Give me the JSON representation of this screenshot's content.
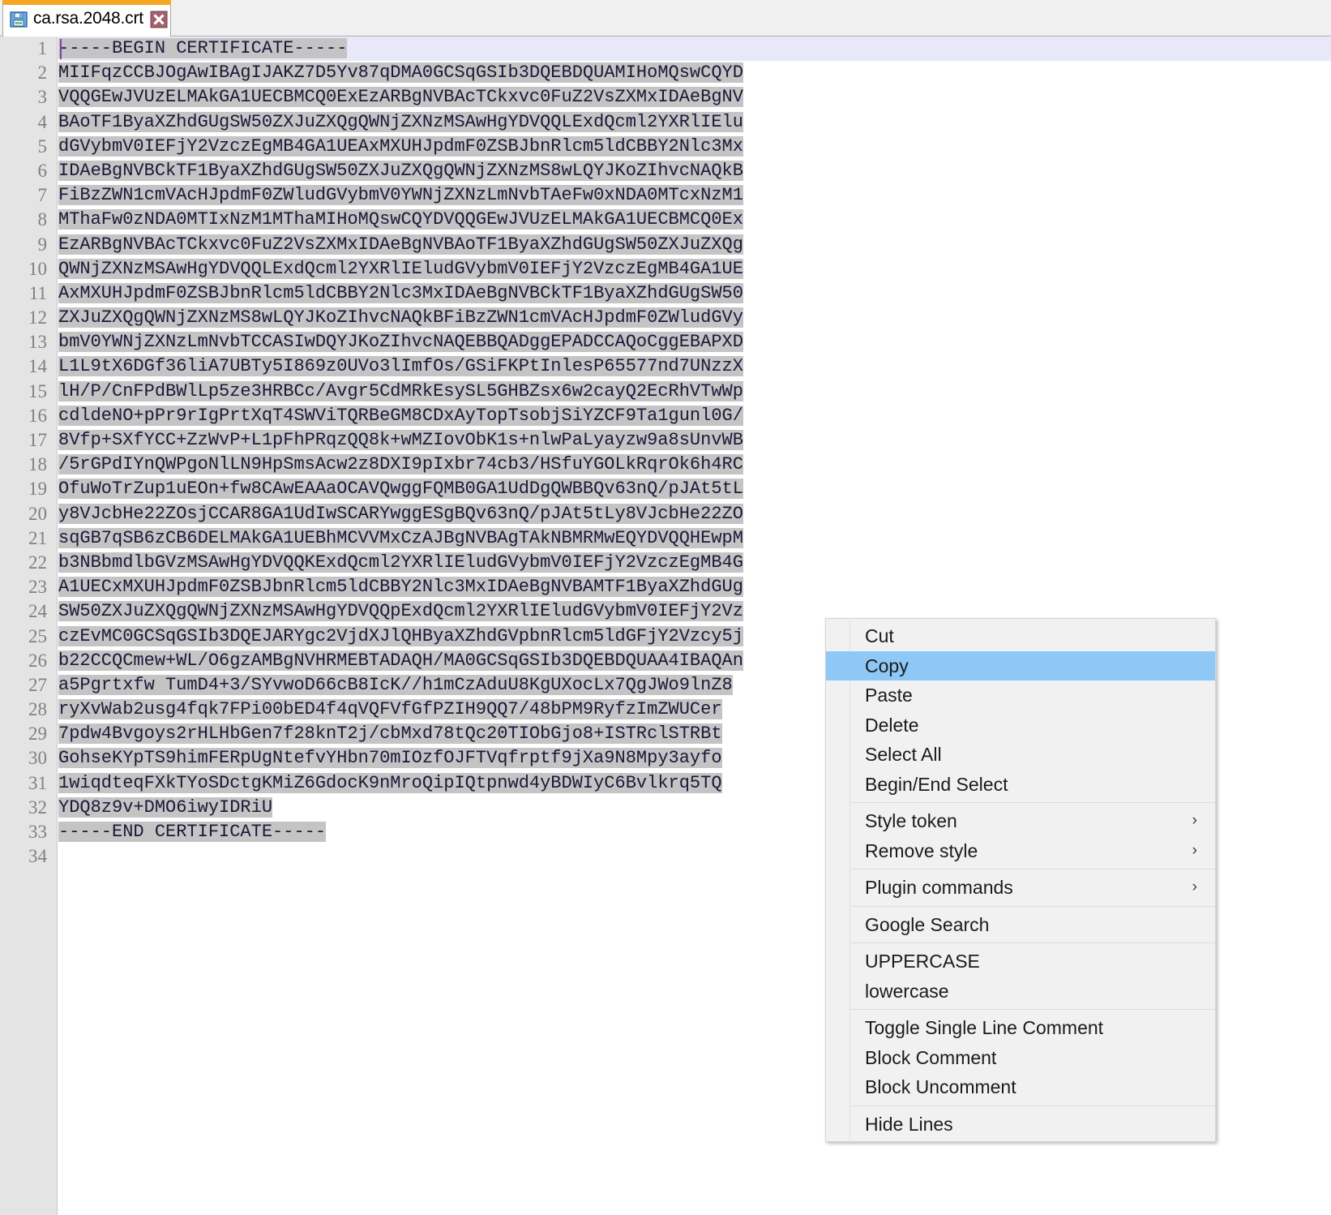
{
  "window": {
    "app": "Notepad++",
    "accent_active_tab": "#f5a623",
    "selection_color": "#c4c4c4",
    "menu_highlight_color": "#8ec8f6"
  },
  "tab": {
    "label": "ca.rsa.2048.crt",
    "icon": "save-floppy-icon",
    "close_icon": "close-x-icon"
  },
  "editor": {
    "total_lines": 34,
    "current_line": 1,
    "line_numbers": [
      1,
      2,
      3,
      4,
      5,
      6,
      7,
      8,
      9,
      10,
      11,
      12,
      13,
      14,
      15,
      16,
      17,
      18,
      19,
      20,
      21,
      22,
      23,
      24,
      25,
      26,
      27,
      28,
      29,
      30,
      31,
      32,
      33,
      34
    ],
    "lines": [
      "-----BEGIN CERTIFICATE-----",
      "MIIFqzCCBJOgAwIBAgIJAKZ7D5Yv87qDMA0GCSqGSIb3DQEBDQUAMIHoMQswCQYD",
      "VQQGEwJVUzELMAkGA1UECBMCQ0ExEzARBgNVBAcTCkxvc0FuZ2VsZXMxIDAeBgNV",
      "BAoTF1ByaXZhdGUgSW50ZXJuZXQgQWNjZXNzMSAwHgYDVQQLExdQcml2YXRlIElu",
      "dGVybmV0IEFjY2VzczEgMB4GA1UEAxMXUHJpdmF0ZSBJbnRlcm5ldCBBY2Nlc3Mx",
      "IDAeBgNVBCkTF1ByaXZhdGUgSW50ZXJuZXQgQWNjZXNzMS8wLQYJKoZIhvcNAQkB",
      "FiBzZWN1cmVAcHJpdmF0ZWludGVybmV0YWNjZXNzLmNvbTAeFw0xNDA0MTcxNzM1",
      "MThaFw0zNDA0MTIxNzM1MThaMIHoMQswCQYDVQQGEwJVUzELMAkGA1UECBMCQ0Ex",
      "EzARBgNVBAcTCkxvc0FuZ2VsZXMxIDAeBgNVBAoTF1ByaXZhdGUgSW50ZXJuZXQg",
      "QWNjZXNzMSAwHgYDVQQLExdQcml2YXRlIEludGVybmV0IEFjY2VzczEgMB4GA1UE",
      "AxMXUHJpdmF0ZSBJbnRlcm5ldCBBY2Nlc3MxIDAeBgNVBCkTF1ByaXZhdGUgSW50",
      "ZXJuZXQgQWNjZXNzMS8wLQYJKoZIhvcNAQkBFiBzZWN1cmVAcHJpdmF0ZWludGVy",
      "bmV0YWNjZXNzLmNvbTCCASIwDQYJKoZIhvcNAQEBBQADggEPADCCAQoCggEBAPXD",
      "L1L9tX6DGf36liA7UBTy5I869z0UVo3lImfOs/GSiFKPtInlesP65577nd7UNzzX",
      "lH/P/CnFPdBWlLp5ze3HRBCc/Avgr5CdMRkEsySL5GHBZsx6w2cayQ2EcRhVTwWp",
      "cdldeNO+pPr9rIgPrtXqT4SWViTQRBeGM8CDxAyTopTsobjSiYZCF9Ta1gunl0G/",
      "8Vfp+SXfYCC+ZzWvP+L1pFhPRqzQQ8k+wMZIovObK1s+nlwPaLyayzw9a8sUnvWB",
      "/5rGPdIYnQWPgoNlLN9HpSmsAcw2z8DXI9pIxbr74cb3/HSfuYGOLkRqrOk6h4RC",
      "OfuWoTrZup1uEOn+fw8CAwEAAaOCAVQwggFQMB0GA1UdDgQWBBQv63nQ/pJAt5tL",
      "y8VJcbHe22ZOsjCCAR8GA1UdIwSCARYwggESgBQv63nQ/pJAt5tLy8VJcbHe22ZO",
      "sqGB7qSB6zCB6DELMAkGA1UEBhMCVVMxCzAJBgNVBAgTAkNBMRMwEQYDVQQHEwpM",
      "b3NBbmdlbGVzMSAwHgYDVQQKExdQcml2YXRlIEludGVybmV0IEFjY2VzczEgMB4G",
      "A1UECxMXUHJpdmF0ZSBJbnRlcm5ldCBBY2Nlc3MxIDAeBgNVBAMTF1ByaXZhdGUg",
      "SW50ZXJuZXQgQWNjZXNzMSAwHgYDVQQpExdQcml2YXRlIEludGVybmV0IEFjY2Vz",
      "czEvMC0GCSqGSIb3DQEJARYgc2VjdXJlQHByaXZhdGVpbnRlcm5ldGFjY2Vzcy5j",
      "b22CCQCmew+WL/O6gzAMBgNVHRMEBTADAQH/MA0GCSqGSIb3DQEBDQUAA4IBAQAn",
      "a5Pgrtxfw TumD4+3/SYvwoD66cB8IcK//h1mCzAduU8KgUXocLx7QgJWo9lnZ8",
      "ryXvWab2usg4fqk7FPi00bED4f4qVQFVfGfPZIH9QQ7/48bPM9RyfzImZWUCer",
      "7pdw4Bvgoys2rHLHbGen7f28knT2j/cbMxd78tQc20TIObGjo8+ISTRclSTRBt",
      "GohseKYpTS9himFERpUgNtefvYHbn70mIOzfOJFTVqfrptf9jXa9N8Mpy3ayfo",
      "1wiqdteqFXkTYoSDctgKMiZ6GdocK9nMroQipIQtpnwd4yBDWIyC6Bvlkrq5TQ",
      "YDQ8z9v+DMO6iwyIDRiU",
      "-----END CERTIFICATE-----",
      ""
    ]
  },
  "context_menu": {
    "items": [
      {
        "label": "Cut",
        "selected": false,
        "submenu": false
      },
      {
        "label": "Copy",
        "selected": true,
        "submenu": false
      },
      {
        "label": "Paste",
        "selected": false,
        "submenu": false
      },
      {
        "label": "Delete",
        "selected": false,
        "submenu": false
      },
      {
        "label": "Select All",
        "selected": false,
        "submenu": false
      },
      {
        "label": "Begin/End Select",
        "selected": false,
        "submenu": false
      },
      {
        "separator": true
      },
      {
        "label": "Style token",
        "selected": false,
        "submenu": true,
        "chevron": "›"
      },
      {
        "label": "Remove style",
        "selected": false,
        "submenu": true,
        "chevron": "›"
      },
      {
        "separator": true
      },
      {
        "label": "Plugin commands",
        "selected": false,
        "submenu": true,
        "chevron": "›"
      },
      {
        "separator": true
      },
      {
        "label": "Google Search",
        "selected": false,
        "submenu": false
      },
      {
        "separator": true
      },
      {
        "label": "UPPERCASE",
        "selected": false,
        "submenu": false
      },
      {
        "label": "lowercase",
        "selected": false,
        "submenu": false
      },
      {
        "separator": true
      },
      {
        "label": "Toggle Single Line Comment",
        "selected": false,
        "submenu": false
      },
      {
        "label": "Block Comment",
        "selected": false,
        "submenu": false
      },
      {
        "label": "Block Uncomment",
        "selected": false,
        "submenu": false
      },
      {
        "separator": true
      },
      {
        "label": "Hide Lines",
        "selected": false,
        "submenu": false
      }
    ]
  }
}
